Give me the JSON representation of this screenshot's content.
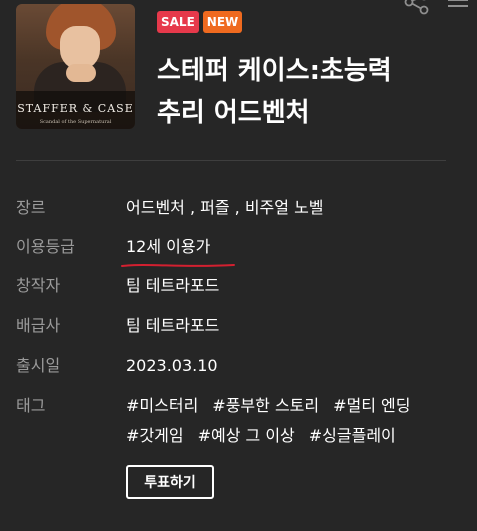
{
  "game": {
    "cover": {
      "logo_text": "STAFFER & CASE",
      "logo_subtitle": "Scandal of the Supernatural"
    },
    "badges": {
      "sale": "SALE",
      "new": "NEW"
    },
    "title_line1": "스테퍼 케이스:초능력",
    "title_line2": "추리 어드벤처"
  },
  "info": {
    "genre": {
      "label": "장르",
      "value": "어드벤처 , 퍼즐 , 비주얼 노벨"
    },
    "rating": {
      "label": "이용등급",
      "value": "12세 이용가"
    },
    "developer": {
      "label": "창작자",
      "value": "팀 테트라포드"
    },
    "publisher": {
      "label": "배급사",
      "value": "팀 테트라포드"
    },
    "release": {
      "label": "출시일",
      "value": "2023.03.10"
    },
    "tags": {
      "label": "태그",
      "items": [
        "#미스터리",
        "#풍부한 스토리",
        "#멀티 엔딩",
        "#갓게임",
        "#예상 그 이상",
        "#싱글플레이"
      ]
    }
  },
  "actions": {
    "vote_label": "투표하기"
  },
  "icons": {
    "share": "share-icon",
    "menu": "more-icon"
  },
  "colors": {
    "background": "#262626",
    "sale": "#e6394b",
    "new": "#ef6a1f",
    "label": "#9a9a9a",
    "annotation": "#d32030"
  }
}
